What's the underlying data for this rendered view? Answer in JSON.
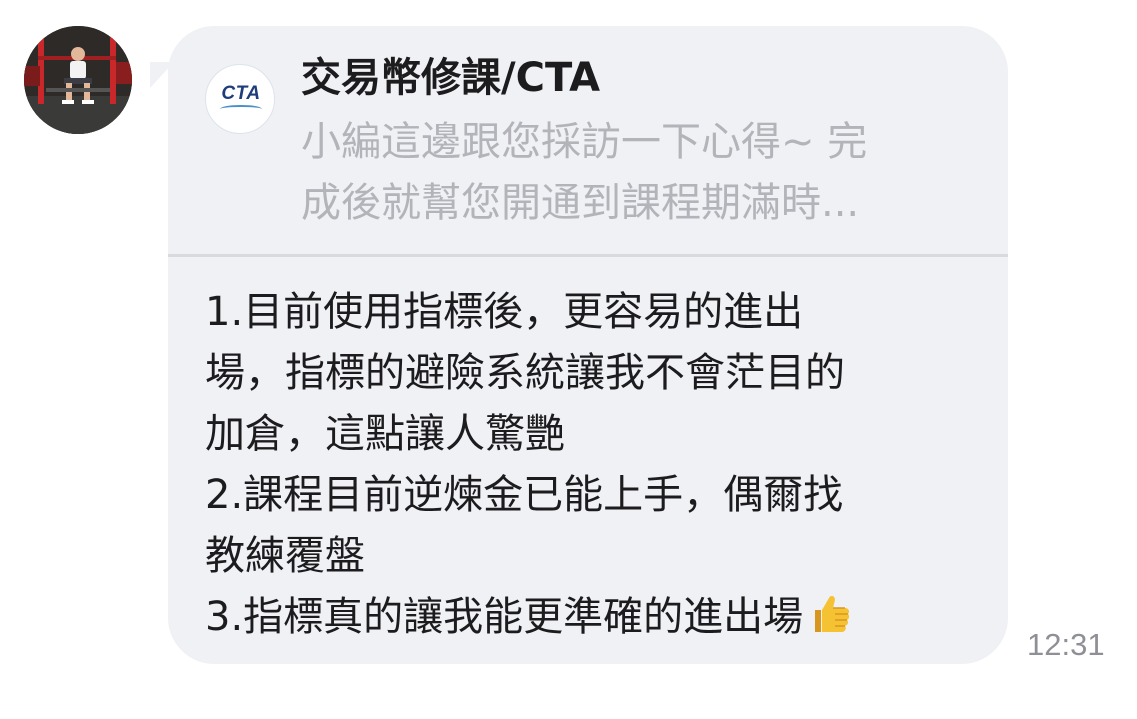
{
  "chat": {
    "sender_avatar": "gym-photo-avatar",
    "reply": {
      "sender": "交易幣修課/CTA",
      "logo_text": "CTA",
      "preview_lines": [
        "小編這邊跟您採訪一下心得~ 完",
        "成後就幫您開通到課程期滿時..."
      ]
    },
    "message_lines": [
      "1.目前使用指標後，更容易的進出",
      "場，指標的避險系統讓我不會茫目的",
      "加倉，這點讓人驚艷",
      "2.課程目前逆煉金已能上手，偶爾找",
      "教練覆盤",
      "3.指標真的讓我能更準確的進出場"
    ],
    "emoji": "thumbs-up-icon",
    "timestamp": "12:31"
  },
  "colors": {
    "bubble_bg": "#f0f1f4",
    "preview_text": "#b2b4ba",
    "body_text": "#1c1c1e",
    "timestamp": "#8e9096",
    "logo_blue": "#1f3d7a"
  }
}
